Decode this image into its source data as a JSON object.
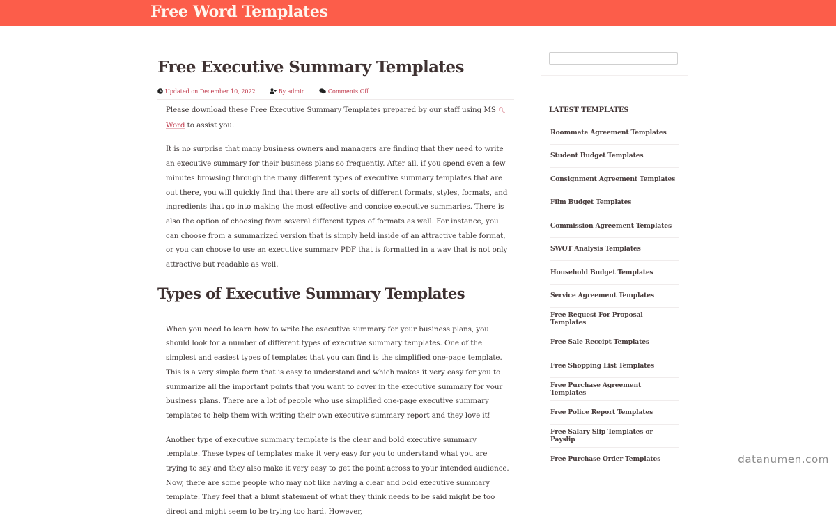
{
  "header": {
    "site_title": "Free Word Templates",
    "brand_color": "#fc5d4a"
  },
  "post": {
    "title": "Free Executive Summary Templates",
    "meta": {
      "updated": "Updated on December 10, 2022",
      "author": "By admin",
      "comments": "Comments Off"
    },
    "intro": {
      "before": "Please download these Free Executive Summary Templates prepared by our staff using MS",
      "link_icon": "search-icon",
      "link": "Word",
      "after": "to assist you."
    },
    "paragraph_1": "It is no surprise that many business owners and managers are finding that they need to write an executive summary for their business plans so frequently. After all, if you spend even a few minutes browsing through the many different types of executive summary templates that are out there, you will quickly find that there are all sorts of different formats, styles, formats, and ingredients that go into making the most effective and concise executive summaries. There is also the option of choosing from several different types of formats as well. For instance, you can choose from a summarized version that is simply held inside of an attractive table format, or you can choose to use an executive summary PDF that is formatted in a way that is not only attractive but readable as well.",
    "section_heading": "Types of Executive Summary Templates",
    "paragraph_2": "When you need to learn how to write the executive summary for your business plans, you should look for a number of different types of executive summary templates. One of the simplest and easiest types of templates that you can find is the simplified one-page template. This is a very simple form that is easy to understand and which makes it very easy for you to summarize all the important points that you want to cover in the executive summary for your business plans. There are a lot of people who use simplified one-page executive summary templates to help them with writing their own executive summary report and they love it!",
    "paragraph_3": "Another type of executive summary template is the clear and bold executive summary template. These types of templates make it very easy for you to understand what you are trying to say and they also make it very easy to get the point across to your intended audience. Now, there are some people who may not like having a clear and bold executive summary template. They feel that a blunt statement of what they think needs to be said might be too direct and might seem to be trying too hard. However,"
  },
  "sidebar": {
    "search": {
      "value": "",
      "placeholder": ""
    },
    "widget_title": "LATEST TEMPLATES",
    "latest": [
      "Roommate Agreement Templates",
      "Student Budget Templates",
      "Consignment Agreement Templates",
      "Film Budget Templates",
      "Commission Agreement Templates",
      "SWOT Analysis Templates",
      "Household Budget Templates",
      "Service Agreement Templates",
      "Free Request For Proposal Templates",
      "Free Sale Receipt Templates",
      "Free Shopping List Templates",
      "Free Purchase Agreement Templates",
      "Free Police Report Templates",
      "Free Salary Slip Templates or Payslip",
      "Free Purchase Order Templates"
    ]
  },
  "watermark": "datanumen.com"
}
